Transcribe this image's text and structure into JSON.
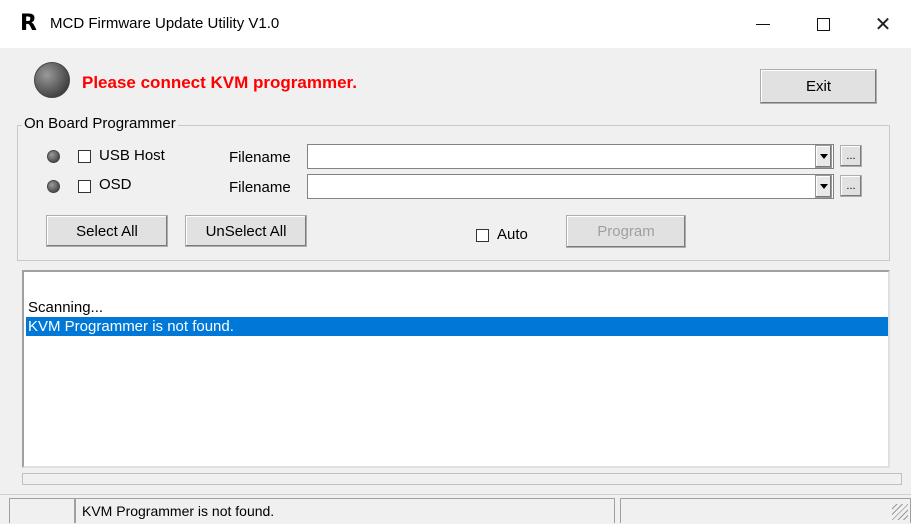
{
  "window": {
    "app_icon": "R",
    "title": "MCD Firmware Update Utility V1.0",
    "controls": [
      "minimize-icon",
      "maximize-icon",
      "close-icon"
    ]
  },
  "header": {
    "message": "Please connect KVM programmer.",
    "message_color": "#ff0000",
    "exit_label": "Exit"
  },
  "programmer": {
    "group_title": "On Board Programmer",
    "rows": [
      {
        "checkbox_label": "USB Host",
        "filename_label": "Filename",
        "filename_value": "",
        "browse_label": "..."
      },
      {
        "checkbox_label": "OSD",
        "filename_label": "Filename",
        "filename_value": "",
        "browse_label": "..."
      }
    ],
    "select_all_label": "Select All",
    "unselect_all_label": "UnSelect All",
    "auto_label": "Auto",
    "program_label": "Program"
  },
  "log": {
    "lines": [
      "",
      "Scanning...",
      "KVM Programmer is not found."
    ],
    "selected_index": 2,
    "selection_color": "#0078d7"
  },
  "statusbar": {
    "text": "KVM Programmer is not found."
  }
}
